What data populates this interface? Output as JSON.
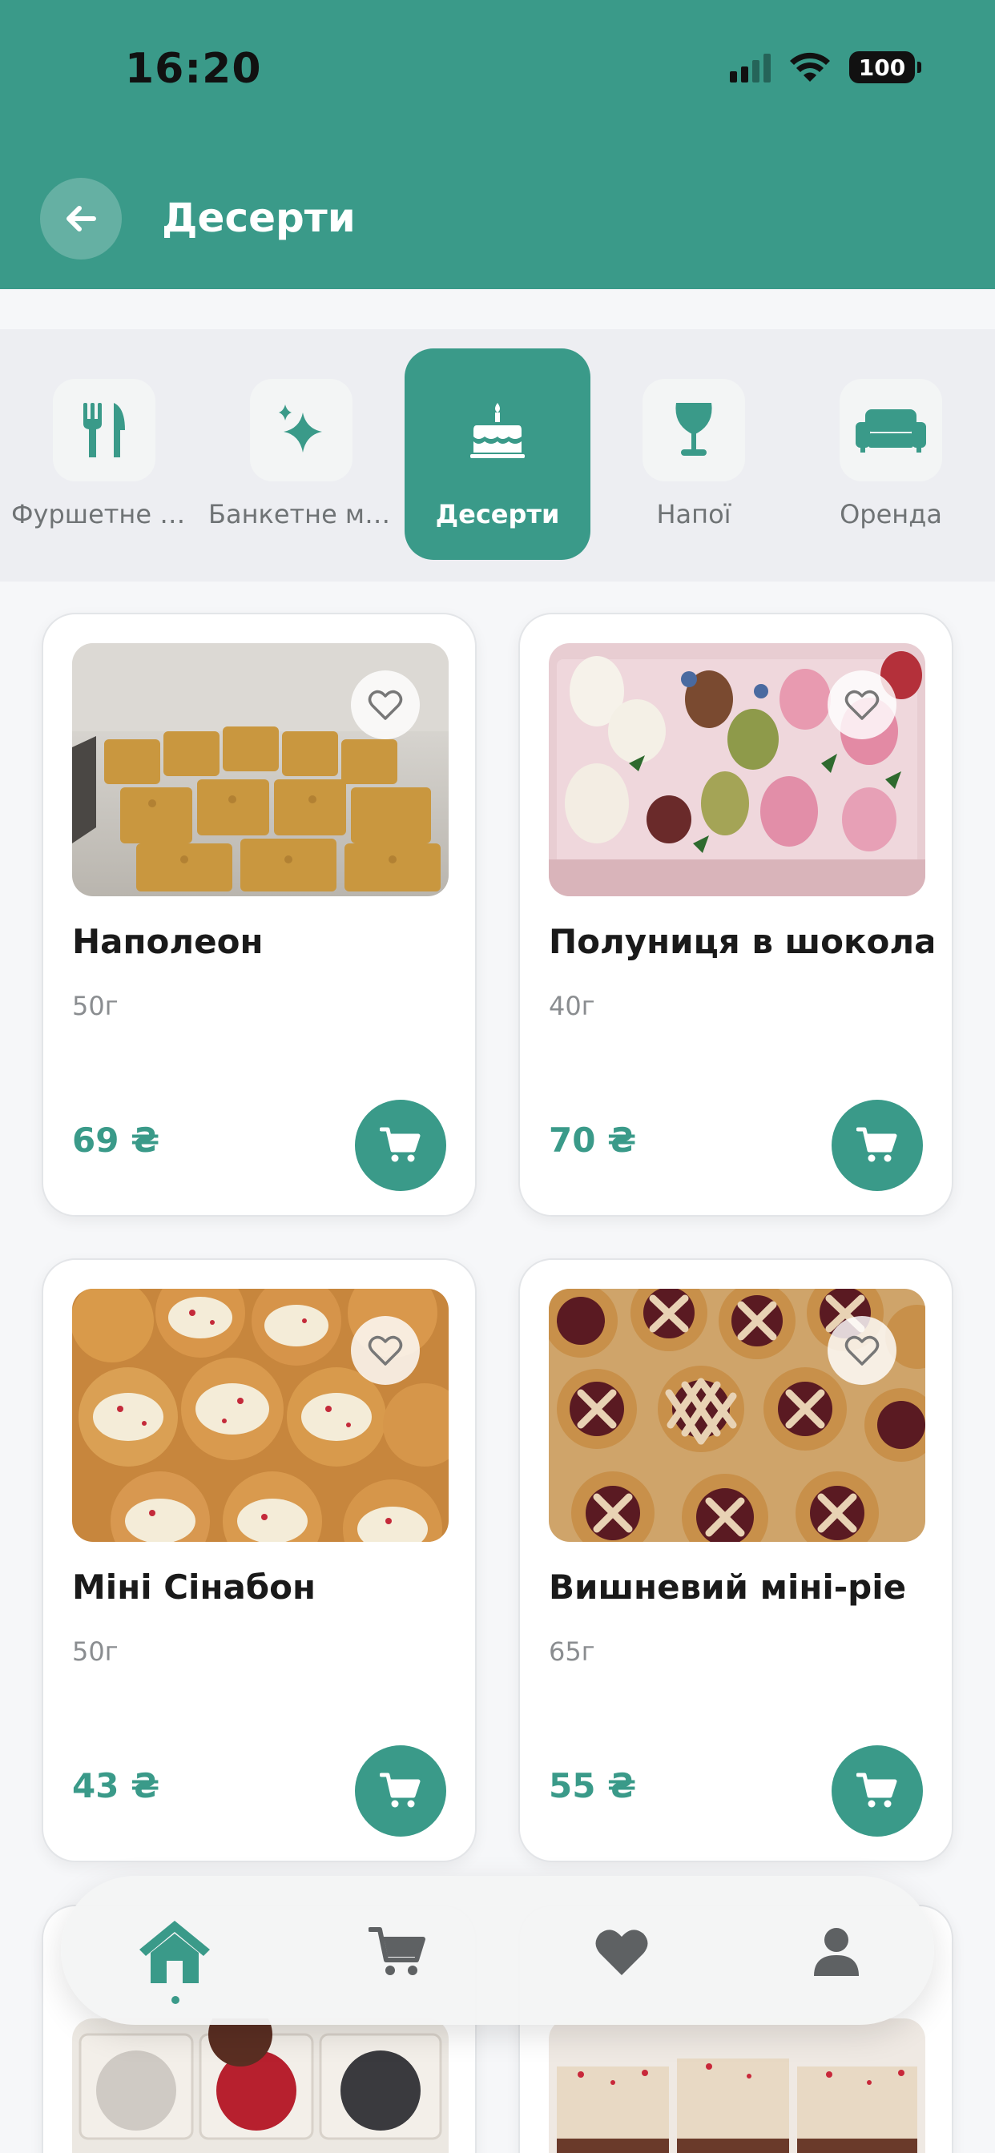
{
  "status_bar": {
    "time": "16:20",
    "battery": "100"
  },
  "header": {
    "title": "Десерти"
  },
  "categories": [
    {
      "label": "Фуршетне меню",
      "icon": "fork-knife-icon",
      "active": false
    },
    {
      "label": "Банкетне меню",
      "icon": "sparkles-icon",
      "active": false
    },
    {
      "label": "Десерти",
      "icon": "cake-icon",
      "active": true
    },
    {
      "label": "Напої",
      "icon": "wine-glass-icon",
      "active": false
    },
    {
      "label": "Оренда",
      "icon": "sofa-icon",
      "active": false
    }
  ],
  "products": [
    {
      "name": "Наполеон",
      "weight": "50г",
      "price": "69 ₴"
    },
    {
      "name": "Полуниця в шоколаді",
      "weight": "40г",
      "price": "70 ₴"
    },
    {
      "name": "Міні Сінабон",
      "weight": "50г",
      "price": "43 ₴"
    },
    {
      "name": "Вишневий міні-pie",
      "weight": "65г",
      "price": "55 ₴"
    }
  ],
  "tab_bar": [
    {
      "icon": "home-icon",
      "active": true
    },
    {
      "icon": "cart-icon",
      "active": false
    },
    {
      "icon": "heart-icon",
      "active": false
    },
    {
      "icon": "profile-icon",
      "active": false
    }
  ],
  "colors": {
    "accent": "#3a9a89",
    "background": "#f6f7f9",
    "category_bar": "#edeef2"
  }
}
